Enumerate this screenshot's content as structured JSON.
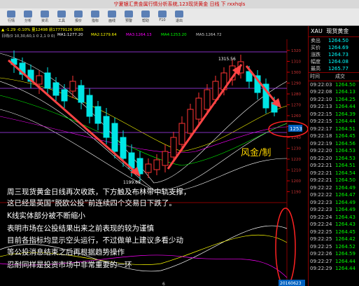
{
  "window": {
    "title": "宁夏银汇贵金属行情分析系统,123现货黄金 日线 下 rxxhqls"
  },
  "toolbar": {
    "buttons": [
      "行情",
      "分析",
      "资讯",
      "工具",
      "报价",
      "指标",
      "画线",
      "预警",
      "帮助",
      "F10",
      "退出"
    ]
  },
  "info": {
    "period": "日线",
    "price_line": "▲ -1.29 -0.10% 量12498 前17779126 9685",
    "ma_line": "日线(0 10,30,60,1 0 2,1 0 0)",
    "ma1": "MA1:1277.20",
    "ma2": "MA2:1279.64",
    "ma3": "MA3:1264.13",
    "ma4": "MA4:1253.20",
    "ma5": "MA5:1264.72"
  },
  "chart": {
    "high_label": "1315.56",
    "low_label": "1199.69",
    "current_price_tag": "1253",
    "watermark": "风金/制",
    "date_label": "20160623",
    "x_tick": "6",
    "y_ticks": [
      "1320",
      "1310",
      "1300",
      "1290",
      "1280",
      "1270",
      "1260",
      "1250",
      "1240",
      "1230",
      "1220",
      "1210",
      "1200",
      "1190"
    ],
    "colors": {
      "up": "#ff3333",
      "down": "#00e5e5",
      "arrow": "#ff4444",
      "ellipse": "#ff2222",
      "purple": "#b040ff"
    }
  },
  "quote": {
    "symbol": "XAU",
    "name": "现货黄金",
    "rows": [
      {
        "k": "卖出",
        "v": "1264.50"
      },
      {
        "k": "买价",
        "v": "1264.69"
      },
      {
        "k": "涨跌",
        "v": "1264.73"
      },
      {
        "k": "幅度",
        "v": "1264.08"
      },
      {
        "k": "最高",
        "v": "1265.77"
      }
    ],
    "ticks_header": {
      "time": "时间",
      "price": "成交"
    },
    "ticks": [
      {
        "t": "09:22:03",
        "p": "1264.50"
      },
      {
        "t": "09:22:08",
        "p": "1264.13"
      },
      {
        "t": "09:22:10",
        "p": "1264.25"
      },
      {
        "t": "09:22:13",
        "p": "1264.44"
      },
      {
        "t": "09:22:15",
        "p": "1264.39"
      },
      {
        "t": "09:22:15",
        "p": "1264.44"
      },
      {
        "t": "09:22:17",
        "p": "1264.51"
      },
      {
        "t": "09:22:18",
        "p": "1264.45"
      },
      {
        "t": "09:22:19",
        "p": "1264.56"
      },
      {
        "t": "09:22:20",
        "p": "1264.53"
      },
      {
        "t": "09:22:20",
        "p": "1264.53"
      },
      {
        "t": "09:22:21",
        "p": "1264.51"
      },
      {
        "t": "09:22:21",
        "p": "1264.54"
      },
      {
        "t": "09:22:21",
        "p": "1264.50"
      },
      {
        "t": "09:22:22",
        "p": "1264.49"
      },
      {
        "t": "09:22:22",
        "p": "1264.47"
      },
      {
        "t": "09:22:23",
        "p": "1264.49"
      },
      {
        "t": "09:22:23",
        "p": "1264.49"
      },
      {
        "t": "09:22:24",
        "p": "1264.43"
      },
      {
        "t": "09:22:24",
        "p": "1264.43"
      },
      {
        "t": "09:22:25",
        "p": "1264.45"
      },
      {
        "t": "09:22:25",
        "p": "1264.42"
      },
      {
        "t": "09:22:25",
        "p": "1264.52"
      },
      {
        "t": "09:22:26",
        "p": "1264.59"
      },
      {
        "t": "09:22:27",
        "p": "1264.44"
      },
      {
        "t": "09:22:29",
        "p": "1264.44"
      }
    ]
  },
  "commentary": [
    "周三现货黄金日线再次收跌，下方触及布林带中轨支撑，",
    "这已经是英国“脱欧公投”前连续四个交易日下跌了。",
    "K线实体部分被不断缩小",
    "表明市场在公投结果出来之前表现的较为谨慎",
    "目前各指标均显示空头运行，不过做单上建议多看少动",
    "等公投消息结束之后再根据趋势操作",
    "忍耐同样是投资市场中非常重要的一环"
  ]
}
